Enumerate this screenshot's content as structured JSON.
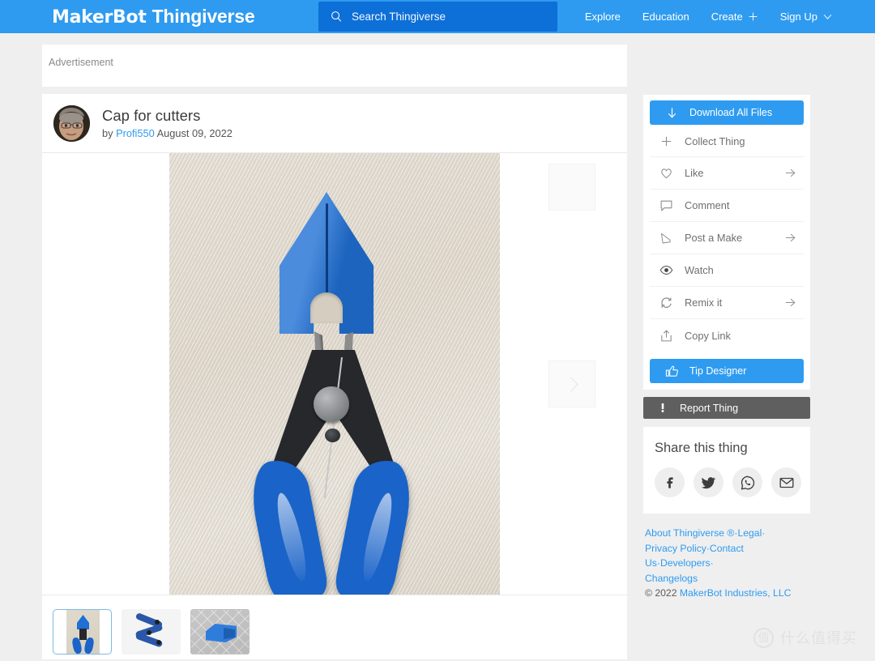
{
  "header": {
    "logo_primary": "MakerBot",
    "logo_secondary": "Thingiverse",
    "search_placeholder": "Search Thingiverse",
    "search_value": "",
    "nav": [
      {
        "label": "Explore",
        "icon": ""
      },
      {
        "label": "Education",
        "icon": ""
      },
      {
        "label": "Create",
        "icon": "plus-icon"
      },
      {
        "label": "Sign Up",
        "icon": "chevron-down-icon"
      }
    ],
    "colors": {
      "bar": "#2e9bf0",
      "search_field": "#0d6fd8",
      "text": "#ffffff"
    }
  },
  "advertisement": {
    "label": "Advertisement"
  },
  "thing": {
    "title": "Cap for cutters",
    "by_prefix": "by",
    "author": "Profi550",
    "date": "August 09, 2022",
    "image_alt": "Blue 3D printed cap above blue-handled flush cutters on light wood background",
    "thumbnails": [
      {
        "name": "cap-on-cutters-photo",
        "selected": true
      },
      {
        "name": "two-cutters-photo",
        "selected": false
      },
      {
        "name": "cap-3d-render",
        "selected": false
      }
    ]
  },
  "sidebar": {
    "download_label": "Download All Files",
    "actions": [
      {
        "label": "Collect Thing",
        "icon": "plus-icon",
        "has_arrow": false
      },
      {
        "label": "Like",
        "icon": "heart-icon",
        "has_arrow": true
      },
      {
        "label": "Comment",
        "icon": "comment-icon",
        "has_arrow": false
      },
      {
        "label": "Post a Make",
        "icon": "pencil-icon",
        "has_arrow": true
      },
      {
        "label": "Watch",
        "icon": "eye-icon",
        "has_arrow": false
      },
      {
        "label": "Remix it",
        "icon": "remix-icon",
        "has_arrow": true
      },
      {
        "label": "Copy Link",
        "icon": "share-upload-icon",
        "has_arrow": false
      }
    ],
    "tip_label": "Tip Designer",
    "report_label": "Report Thing",
    "colors": {
      "primary_button": "#2e9bf0",
      "report_button": "#5f5f5f"
    }
  },
  "share": {
    "title": "Share this thing",
    "buttons": [
      {
        "name": "facebook-icon",
        "label": "Facebook"
      },
      {
        "name": "twitter-icon",
        "label": "Twitter"
      },
      {
        "name": "whatsapp-icon",
        "label": "WhatsApp"
      },
      {
        "name": "email-icon",
        "label": "Email"
      }
    ]
  },
  "footer": {
    "links": [
      "About Thingiverse ®",
      "Legal",
      "Privacy Policy",
      "Contact Us",
      "Developers",
      "Changelogs"
    ],
    "separator": "·",
    "copyright_symbol": "©",
    "copyright_year": "2022",
    "copyright_owner": "MakerBot Industries, LLC"
  },
  "watermark": {
    "glyph": "值",
    "text": "什么值得买"
  }
}
